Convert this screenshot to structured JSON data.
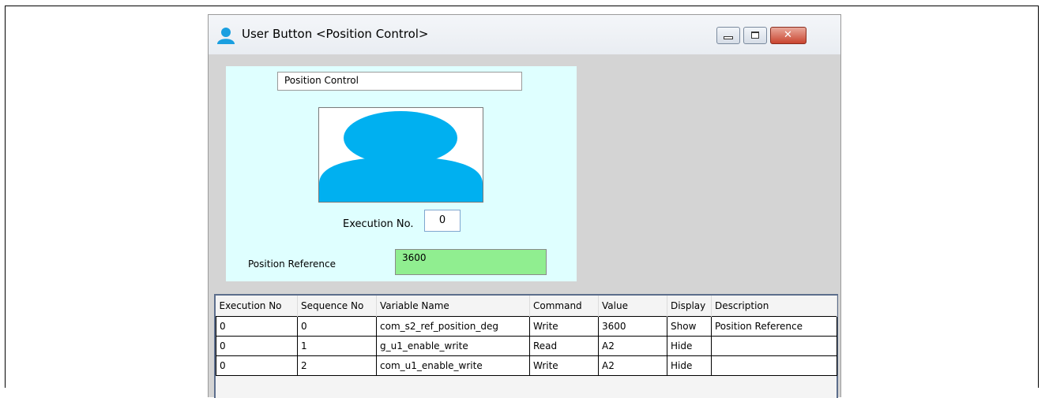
{
  "window": {
    "title": "User Button <Position Control>"
  },
  "panel": {
    "name_value": "Position Control",
    "execution_label": "Execution No.",
    "execution_value": "0",
    "reference_label": "Position Reference",
    "reference_value": "3600"
  },
  "table": {
    "headers": [
      "Execution No",
      "Sequence No",
      "Variable Name",
      "Command",
      "Value",
      "Display",
      "Description"
    ],
    "rows": [
      [
        "0",
        "0",
        "com_s2_ref_position_deg",
        "Write",
        "3600",
        "Show",
        "Position Reference"
      ],
      [
        "0",
        "1",
        "g_u1_enable_write",
        "Read",
        "A2",
        "Hide",
        ""
      ],
      [
        "0",
        "2",
        "com_u1_enable_write",
        "Write",
        "A2",
        "Hide",
        ""
      ]
    ]
  },
  "icons": {
    "title": "user-icon",
    "avatar": "user-avatar-icon"
  },
  "colors": {
    "panel_bg": "#dfffff",
    "reference_bg": "#90ee90",
    "avatar": "#00b0f0",
    "close_button": "#c9442f"
  }
}
